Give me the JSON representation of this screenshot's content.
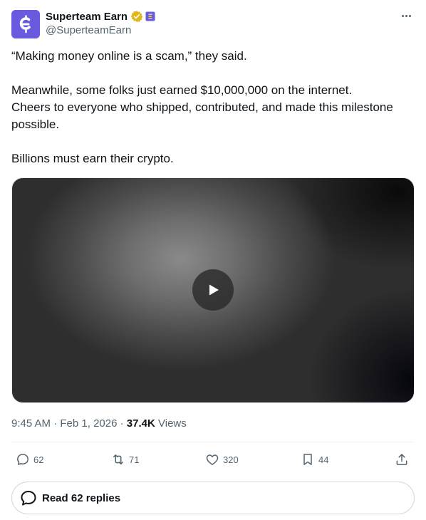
{
  "header": {
    "display_name": "Superteam Earn",
    "handle": "@SuperteamEarn",
    "avatar_icon": "superteam-logo",
    "avatar_color": "#6a5ae0",
    "verified_icon": "gold-verified-badge",
    "affiliate_icon": "superteam-affiliate-badge"
  },
  "tweet": {
    "line1": "“Making money online is a scam,” they said.",
    "line2": "Meanwhile, some folks just earned $10,000,000 on the internet.",
    "line3": "Cheers to everyone who shipped, contributed, and made this milestone possible.",
    "line4": "Billions must earn their crypto."
  },
  "media": {
    "type": "video",
    "play_icon": "play-icon"
  },
  "meta": {
    "time": "9:45 AM",
    "date": "Feb 1, 2026",
    "views_count": "37.4K",
    "views_label": "Views"
  },
  "actions": {
    "reply_count": "62",
    "repost_count": "71",
    "like_count": "320",
    "bookmark_count": "44"
  },
  "replies_button": {
    "label": "Read 62 replies"
  },
  "colors": {
    "text_primary": "#0f1419",
    "text_secondary": "#536471",
    "verified_gold": "#e2b719",
    "border": "#cfd9de"
  }
}
